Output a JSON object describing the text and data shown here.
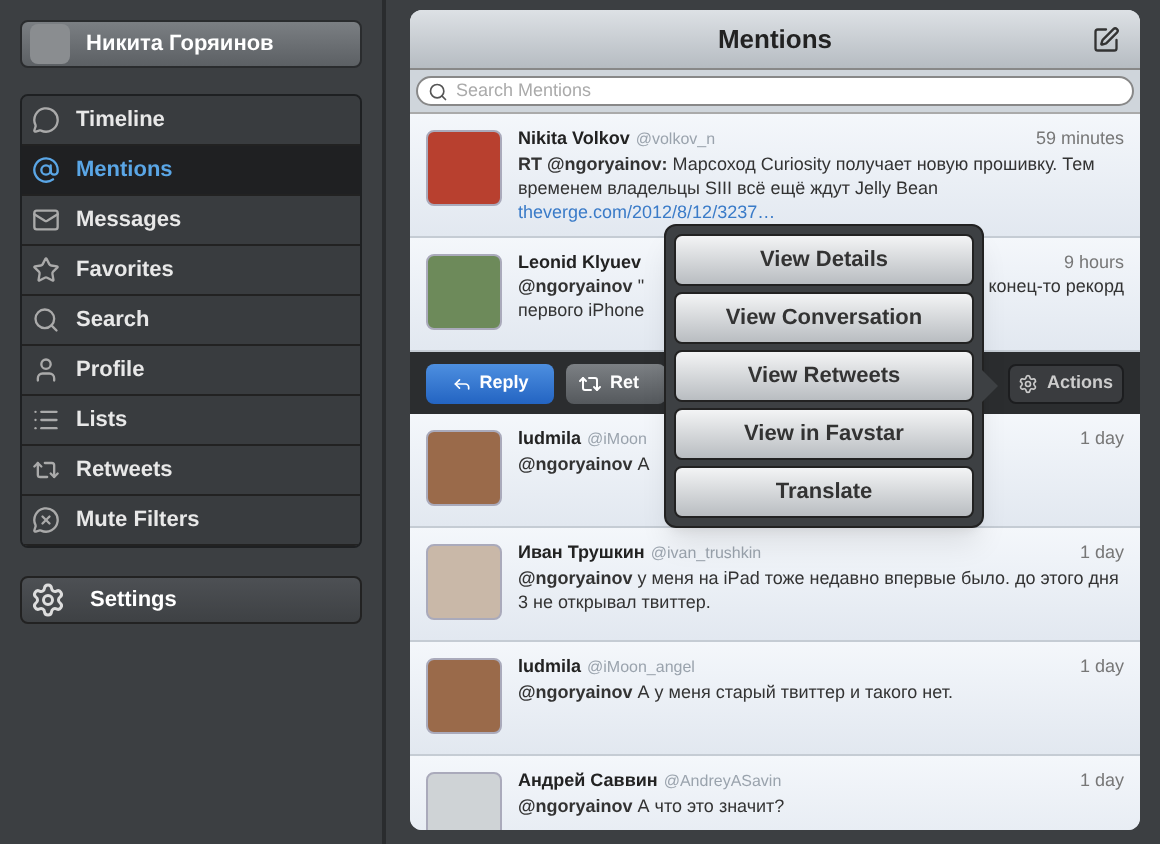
{
  "account": {
    "name": "Никита Горяинов"
  },
  "sidebar": {
    "items": [
      {
        "label": "Timeline",
        "selected": false
      },
      {
        "label": "Mentions",
        "selected": true
      },
      {
        "label": "Messages",
        "selected": false
      },
      {
        "label": "Favorites",
        "selected": false
      },
      {
        "label": "Search",
        "selected": false
      },
      {
        "label": "Profile",
        "selected": false
      },
      {
        "label": "Lists",
        "selected": false
      },
      {
        "label": "Retweets",
        "selected": false
      },
      {
        "label": "Mute Filters",
        "selected": false
      }
    ]
  },
  "settings": {
    "label": "Settings"
  },
  "header": {
    "title": "Mentions"
  },
  "search": {
    "placeholder": "Search Mentions"
  },
  "tweets": [
    {
      "name": "Nikita Volkov",
      "handle": "@volkov_n",
      "time": "59 minutes",
      "mention": "RT @ngoryainov:",
      "text": " Марсоход Curiosity получает новую прошивку. Тем временем владельцы SIII всё ещё ждут Jelly Bean ",
      "link": "theverge.com/2012/8/12/3237…"
    },
    {
      "name": "Leonid Klyuev",
      "time": "9 hours",
      "mention": "@ngoryainov",
      "text": "\"",
      "text_right": "конец-то рекорд",
      "text_line2": "первого iPhone"
    },
    {
      "name": "ludmila",
      "handle": "@iMoon",
      "time": "1 day",
      "mention": "@ngoryainov",
      "text": " А"
    },
    {
      "name": "Иван Трушкин",
      "handle": "@ivan_trushkin",
      "time": "1 day",
      "mention": "@ngoryainov",
      "text": " у меня на iPad тоже недавно впервые было. до этого дня 3 не открывал твиттер."
    },
    {
      "name": "ludmila",
      "handle": "@iMoon_angel",
      "time": "1 day",
      "mention": "@ngoryainov",
      "text": " А у меня старый твиттер и такого нет."
    },
    {
      "name": "Андрей Саввин",
      "handle": "@AndreyASavin",
      "time": "1 day",
      "mention": "@ngoryainov",
      "text": " А что это значит?"
    }
  ],
  "action_bar": {
    "reply": "Reply",
    "retweet": "Ret",
    "actions": "Actions"
  },
  "popover": {
    "items": [
      "View Details",
      "View Conversation",
      "View Retweets",
      "View in Favstar",
      "Translate"
    ]
  }
}
